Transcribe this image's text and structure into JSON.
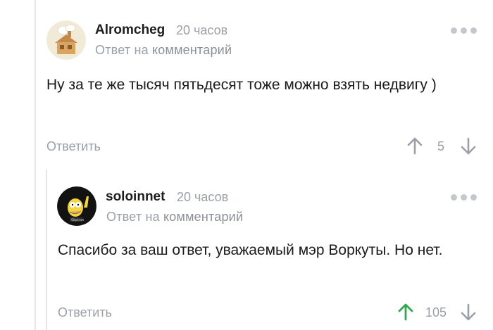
{
  "comments": [
    {
      "author": "Alromcheg",
      "time": "20 часов",
      "reply_prefix": "Ответ на",
      "reply_link": "комментарий",
      "text": "Ну за те же тысяч пятьдесят тоже можно взять недвигу )",
      "reply_label": "Ответить",
      "score": "5",
      "upvoted": false
    },
    {
      "author": "soloinnet",
      "time": "20 часов",
      "reply_prefix": "Ответ на",
      "reply_link": "комментарий",
      "text": "Спасибо за ваш ответ, уважаемый мэр Воркуты. Но нет.",
      "reply_label": "Ответить",
      "score": "105",
      "upvoted": true
    }
  ],
  "colors": {
    "muted": "#9aa0a5",
    "upvote_active": "#2fa84f",
    "thread_line": "#e4e6e8"
  }
}
